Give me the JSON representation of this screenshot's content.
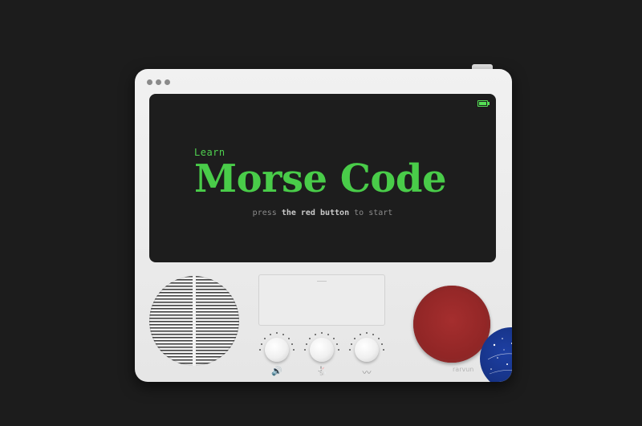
{
  "screen": {
    "learn_label": "Learn",
    "title": "Morse Code",
    "prompt_pre": "press",
    "prompt_highlight": "the red button",
    "prompt_post": "to start"
  },
  "controls": {
    "knobs": [
      {
        "icon": "volume-icon",
        "glyph": "🔊"
      },
      {
        "icon": "rabbit-speed-icon",
        "glyph": "🐇"
      },
      {
        "icon": "waveform-icon",
        "glyph": "〰"
      }
    ],
    "main_button": "red-start-button"
  },
  "brand": "rarvun",
  "colors": {
    "screen_text": "#49cc49",
    "button_red": "#952828",
    "body": "#e9e9e9",
    "screen_bg": "#1d1d1d"
  }
}
